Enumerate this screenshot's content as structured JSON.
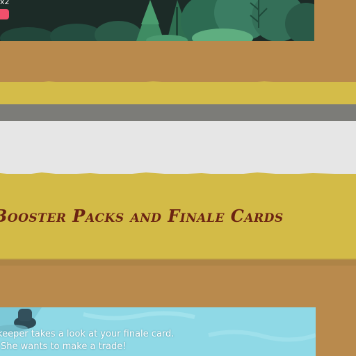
{
  "top_panel": {
    "level_label": "x2"
  },
  "banner": {
    "title": "Booster Packs and Finale Cards"
  },
  "dialogue": {
    "line1": "keeper takes a look at your finale card.",
    "line2": "She wants to make a trade!"
  },
  "colors": {
    "background_brown": "#b98a4d",
    "banner_yellow": "#d3bb47",
    "banner_text": "#6b2312",
    "dialogue_bg": "#8fd9e6",
    "forest_bg": "#1a2a26",
    "badge_pink": "#f0506c"
  }
}
